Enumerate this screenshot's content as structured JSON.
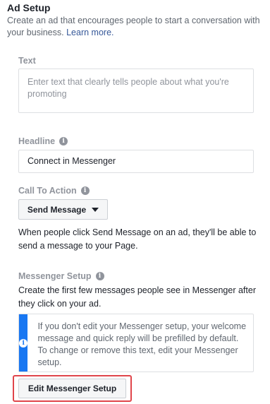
{
  "header": {
    "title": "Ad Setup",
    "description": "Create an ad that encourages people to start a conversation with your business.",
    "learn_more": "Learn more."
  },
  "text_field": {
    "label": "Text",
    "placeholder": "Enter text that clearly tells people about what you're promoting"
  },
  "headline": {
    "label": "Headline",
    "value": "Connect in Messenger"
  },
  "cta": {
    "label": "Call To Action",
    "selected": "Send Message",
    "help": "When people click Send Message on an ad, they'll be able to send a message to your Page."
  },
  "messenger_setup": {
    "label": "Messenger Setup",
    "description": "Create the first few messages people see in Messenger after they click on your ad.",
    "notice": "If you don't edit your Messenger setup, your welcome message and quick reply will be prefilled by default. To change or remove this text, edit your Messenger setup.",
    "button_label": "Edit Messenger Setup"
  },
  "colors": {
    "accent": "#1877f2",
    "highlight": "#e0454b"
  }
}
